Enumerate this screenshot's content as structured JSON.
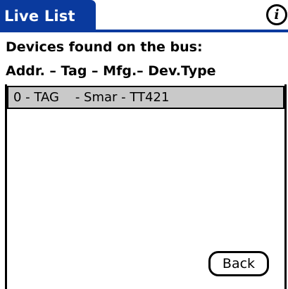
{
  "app": {
    "title": "Live List",
    "info_icon_glyph": "i",
    "accent_color": "#0a3a9e"
  },
  "main": {
    "heading": "Devices found on the bus:",
    "columns_header": "Addr. – Tag – Mfg.– Dev.Type",
    "devices": [
      {
        "label": "0 - TAG    - Smar - TT421",
        "selected": true
      }
    ]
  },
  "buttons": {
    "back_label": "Back"
  }
}
